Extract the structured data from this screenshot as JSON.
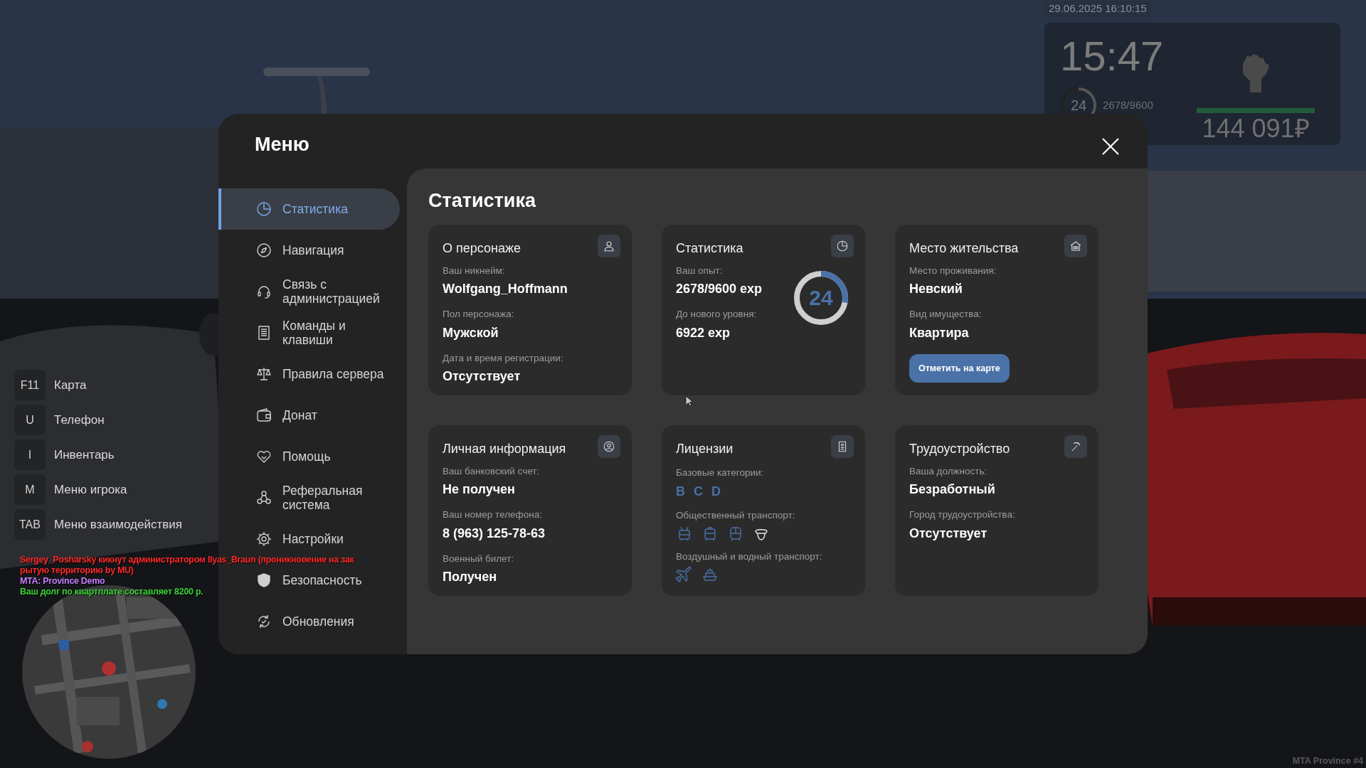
{
  "hud": {
    "datetime": "29.06.2025 16:10:15",
    "time": "15:47",
    "level_number": "24",
    "xp": "2678/9600",
    "xp_ring": {
      "level": 0.35
    },
    "health_bar": {
      "level": 1
    },
    "money": "144 091₽"
  },
  "key_hints": [
    {
      "key": "F11",
      "label": "Карта"
    },
    {
      "key": "U",
      "label": "Телефон"
    },
    {
      "key": "I",
      "label": "Инвентарь"
    },
    {
      "key": "M",
      "label": "Меню игрока"
    },
    {
      "key": "TAB",
      "label": "Меню взаимодействия"
    }
  ],
  "chat": [
    {
      "text": "Sergey_Posharsky кикнут администратором Ilyas_Braun (проникновение на зак",
      "color": "#ff2a2a"
    },
    {
      "text": "рытую территорию by MU)",
      "color": "#ff2a2a"
    },
    {
      "text": "MTA: Province Demo",
      "color": "#c77dff"
    },
    {
      "text": "Ваш долг по квартплате составляет 8200 р.",
      "color": "#3ad23a"
    }
  ],
  "server_label": "MTA Province #4",
  "menu": {
    "title": "Меню",
    "sidebar": [
      {
        "label": "Статистика",
        "selected": true
      },
      {
        "label": "Навигация",
        "selected": false
      },
      {
        "label": "Связь с администрацией",
        "selected": false
      },
      {
        "label": "Команды и клавиши",
        "selected": false
      },
      {
        "label": "Правила сервера",
        "selected": false
      },
      {
        "label": "Донат",
        "selected": false
      },
      {
        "label": "Помощь",
        "selected": false
      },
      {
        "label": "Реферальная система",
        "selected": false
      },
      {
        "label": "Настройки",
        "selected": false
      },
      {
        "label": "Безопасность",
        "selected": false
      },
      {
        "label": "Обновления",
        "selected": false
      }
    ],
    "page_title": "Статистика",
    "cards": [
      {
        "kind": "fields",
        "title": "О персонаже",
        "fields": [
          {
            "label": "Ваш никнейм:",
            "value": "Wolfgang_Hoffmann"
          },
          {
            "label": "Пол персонажа:",
            "value": "Мужской"
          },
          {
            "label": "Дата и время регистрации:",
            "value": "Отсутствует"
          }
        ]
      },
      {
        "kind": "stats",
        "title": "Статистика",
        "fields": [
          {
            "label": "Ваш опыт:",
            "value": "2678/9600 exp"
          },
          {
            "label": "До нового уровня:",
            "value": "6922 exp"
          }
        ],
        "ring": {
          "value": "24",
          "level": 0.28
        }
      },
      {
        "kind": "fields",
        "title": "Место жительства",
        "fields": [
          {
            "label": "Место проживания:",
            "value": "Невский"
          },
          {
            "label": "Вид имущества:",
            "value": "Квартира"
          }
        ],
        "button": "Отметить на карте"
      },
      {
        "kind": "fields",
        "title": "Личная информация",
        "fields": [
          {
            "label": "Ваш банковский счет:",
            "value": "Не получен"
          },
          {
            "label": "Ваш номер телефона:",
            "value": "8 (963) 125-78-63"
          },
          {
            "label": "Военный билет:",
            "value": "Получен"
          }
        ]
      },
      {
        "kind": "licenses",
        "title": "Лицензии",
        "sections": [
          {
            "label": "Базовые категории:",
            "categories": [
              "B",
              "C",
              "D"
            ]
          },
          {
            "label": "Общественный транспорт:",
            "vehicles": [
              {
                "kind": "trolleybus",
                "owned": true
              },
              {
                "kind": "tram",
                "owned": true
              },
              {
                "kind": "train",
                "owned": true
              },
              {
                "kind": "captain",
                "owned": false
              }
            ]
          },
          {
            "label": "Воздушный и водный транспорт:",
            "vehicles": [
              {
                "kind": "plane",
                "owned": true
              },
              {
                "kind": "ship",
                "owned": true
              }
            ]
          }
        ]
      },
      {
        "kind": "fields",
        "title": "Трудоустройство",
        "fields": [
          {
            "label": "Ваша должность:",
            "value": "Безработный"
          },
          {
            "label": "Город трудоустройства:",
            "value": "Отсутствует"
          }
        ]
      }
    ]
  }
}
